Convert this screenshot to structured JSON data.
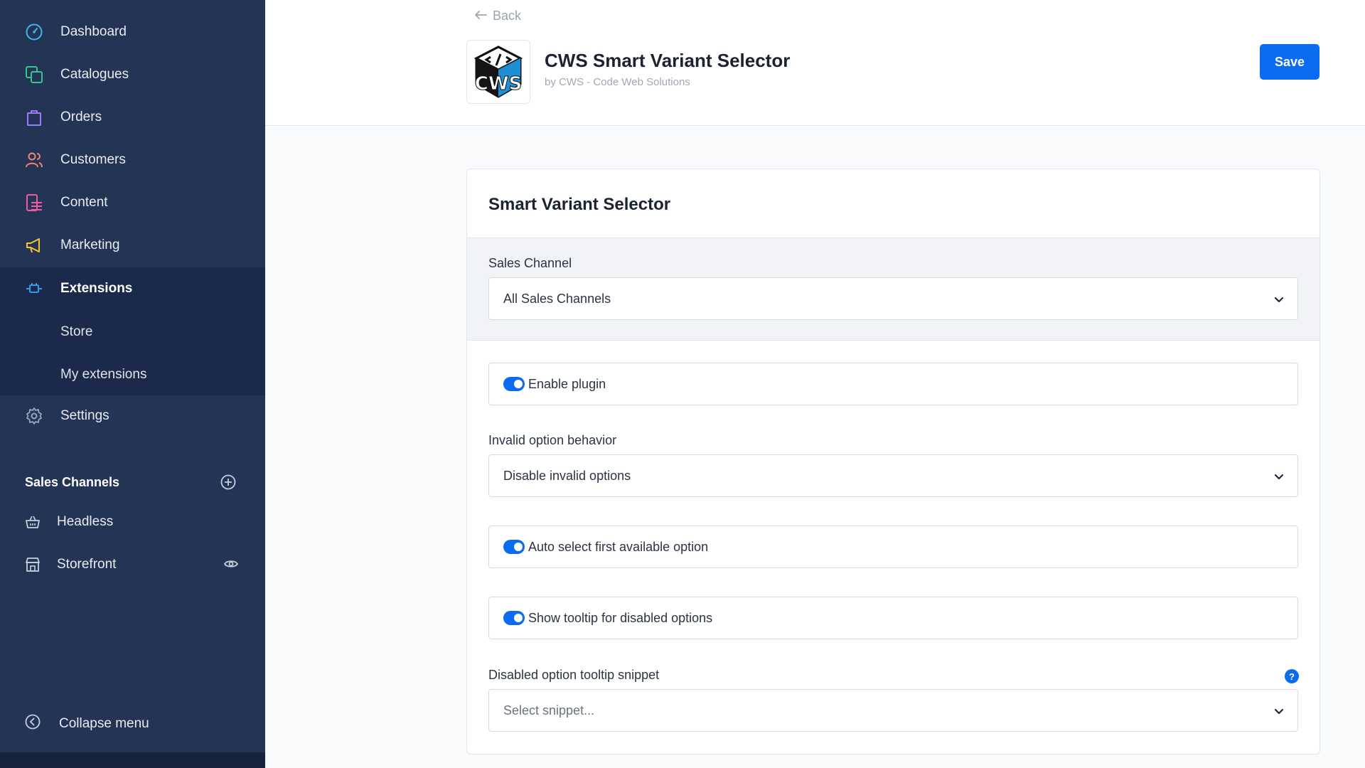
{
  "sidebar": {
    "items": [
      {
        "label": "Dashboard",
        "icon": "dashboard-icon",
        "color": "#3fb4f0"
      },
      {
        "label": "Catalogues",
        "icon": "catalogues-icon",
        "color": "#39c38f"
      },
      {
        "label": "Orders",
        "icon": "orders-icon",
        "color": "#9a7cf4"
      },
      {
        "label": "Customers",
        "icon": "customers-icon",
        "color": "#f4866d"
      },
      {
        "label": "Content",
        "icon": "content-icon",
        "color": "#f05ba0"
      },
      {
        "label": "Marketing",
        "icon": "marketing-icon",
        "color": "#f4c431"
      },
      {
        "label": "Extensions",
        "icon": "extensions-icon",
        "color": "#2f9cf0"
      },
      {
        "label": "Settings",
        "icon": "gear-icon",
        "color": "#9aa6b8"
      }
    ],
    "extensions_sub": [
      "Store",
      "My extensions"
    ],
    "sales_channels_heading": "Sales Channels",
    "sales_channels": [
      {
        "label": "Headless",
        "icon": "basket-icon"
      },
      {
        "label": "Storefront",
        "icon": "storefront-icon"
      }
    ],
    "collapse_label": "Collapse menu"
  },
  "header": {
    "back_label": "Back",
    "app_title": "CWS Smart Variant Selector",
    "app_vendor": "by CWS - Code Web Solutions",
    "save_label": "Save",
    "logo_text": "CWS"
  },
  "card": {
    "title": "Smart Variant Selector",
    "sales_channel_label": "Sales Channel",
    "sales_channel_value": "All Sales Channels",
    "enable_plugin_label": "Enable plugin",
    "invalid_option_label": "Invalid option behavior",
    "invalid_option_value": "Disable invalid options",
    "auto_select_label": "Auto select first available option",
    "show_tooltip_label": "Show tooltip for disabled options",
    "tooltip_snippet_label": "Disabled option tooltip snippet",
    "tooltip_snippet_placeholder": "Select snippet...",
    "help_glyph": "?"
  },
  "colors": {
    "sidebar_bg": "#243455",
    "sidebar_active_bg": "#1b2a4b",
    "accent": "#0b6cf0"
  }
}
